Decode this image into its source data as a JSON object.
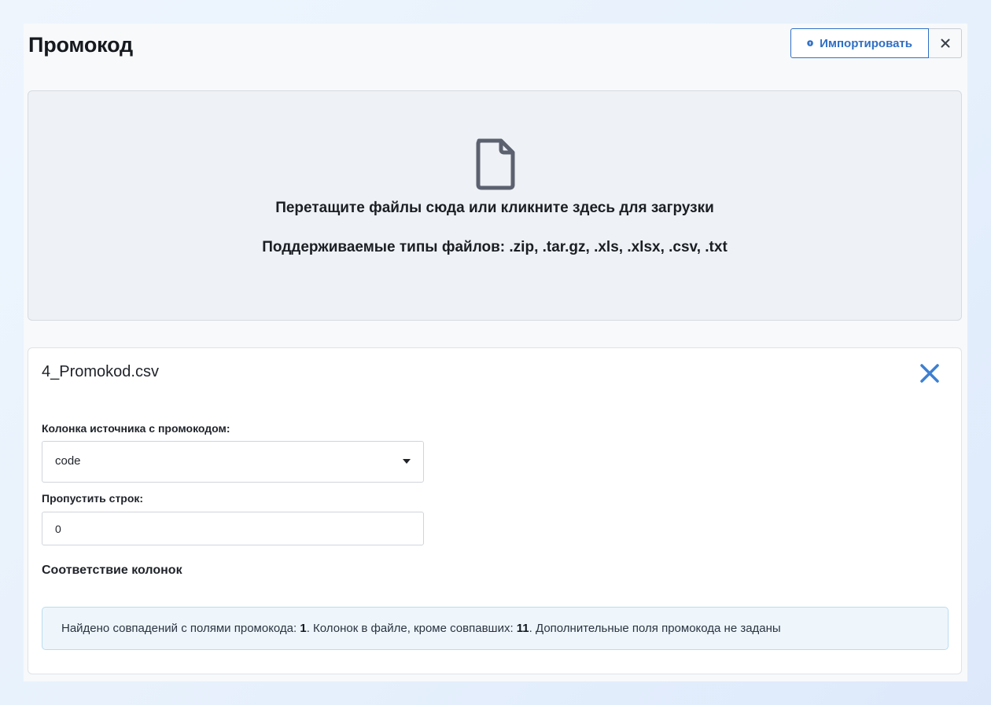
{
  "header": {
    "title": "Промокод",
    "import_label": "Импортировать",
    "import_icon": "upload-circle-icon",
    "close_icon": "close-icon"
  },
  "dropzone": {
    "icon": "file-icon",
    "title": "Перетащите файлы сюда или кликните здесь для загрузки",
    "supported_types": "Поддерживаемые типы файлов: .zip, .tar.gz, .xls, .xlsx, .csv, .txt"
  },
  "file_card": {
    "file_name": "4_Promokod.csv",
    "remove_icon": "close-icon",
    "column_field": {
      "label": "Колонка источника с промокодом:",
      "value": "code"
    },
    "skip_rows_field": {
      "label": "Пропустить строк:",
      "value": "0"
    },
    "mapping_heading": "Соответствие колонок",
    "info": {
      "prefix": "Найдено совпадений с полями промокода: ",
      "matches_count": "1",
      "middle": ". Колонок в файле, кроме совпавших: ",
      "other_columns_count": "11",
      "suffix": ". Дополнительные поля промокода не заданы"
    }
  },
  "colors": {
    "accent": "#2f6fc4",
    "remove_icon": "#3d7fd1",
    "file_icon": "#5c6170",
    "info_background": "#eef6fc",
    "info_border": "#bcdcf0"
  }
}
